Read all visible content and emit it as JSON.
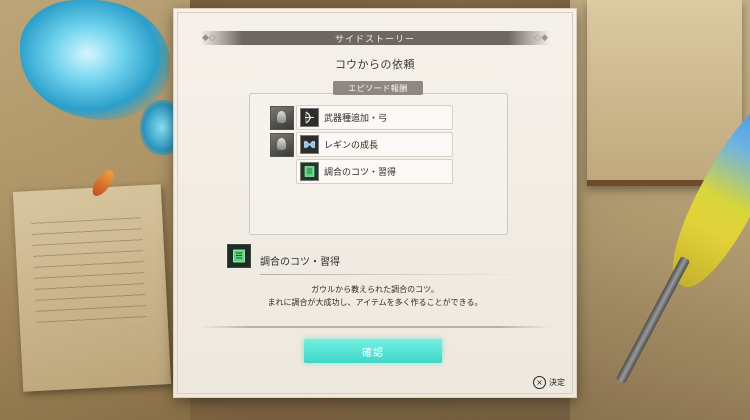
{
  "header": {
    "title": "サイドストーリー"
  },
  "quest": {
    "title": "コウからの依頼"
  },
  "rewards": {
    "heading": "エピソード報酬",
    "items": [
      {
        "label": "武器種追加・弓",
        "icon": "bow-icon",
        "has_character": true
      },
      {
        "label": "レギンの成長",
        "icon": "butterfly-icon",
        "has_character": true
      },
      {
        "label": "調合のコツ・習得",
        "icon": "scroll-book-icon",
        "has_character": false
      }
    ]
  },
  "detail": {
    "title": "調合のコツ・習得",
    "icon": "scroll-book-icon",
    "description_line1": "ガウルから教えられた調合のコツ。",
    "description_line2": "まれに調合が大成功し、アイテムを多く作ることができる。"
  },
  "buttons": {
    "confirm_label": "確認"
  },
  "footer": {
    "confirm_hint_button": "×",
    "confirm_hint_label": "決定"
  },
  "colors": {
    "accent": "#4ee0d0",
    "header_band": "#6d675f",
    "panel": "#f3efe8"
  }
}
